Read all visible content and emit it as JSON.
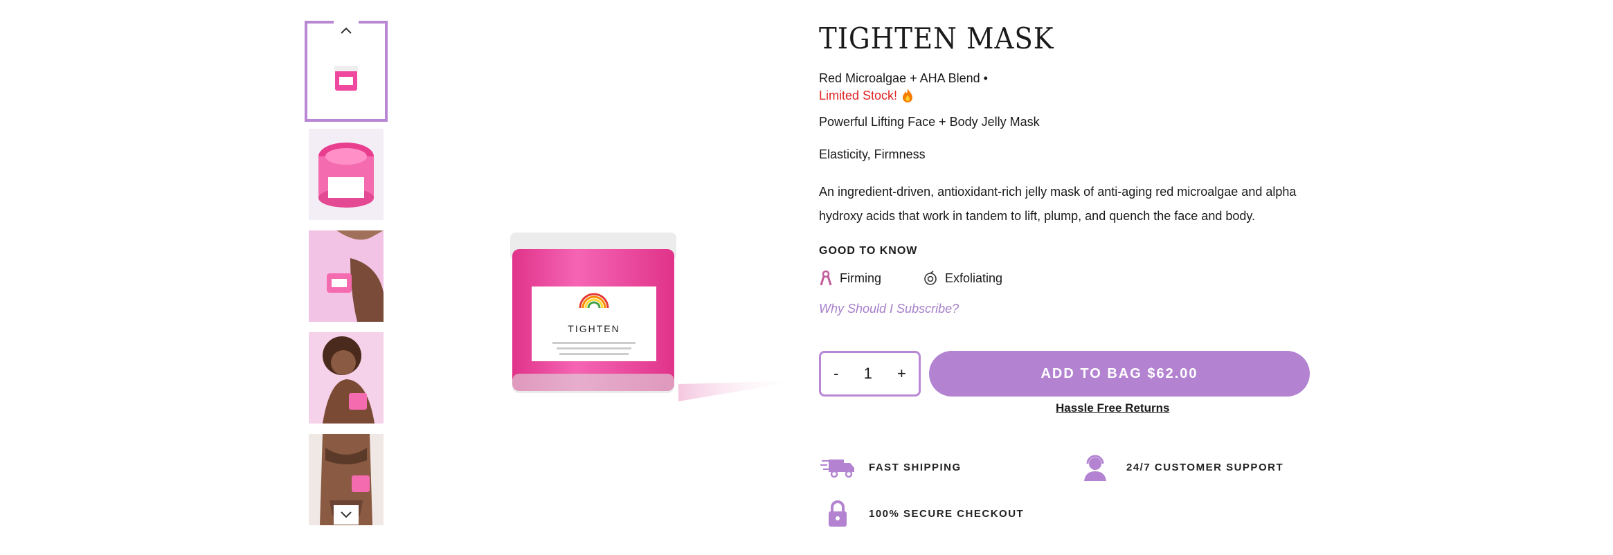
{
  "product": {
    "title": "TIGHTEN MASK",
    "subtitle": "Red Microalgae + AHA Blend •",
    "stock": "Limited Stock!",
    "tagline": "Powerful Lifting Face + Body Jelly Mask",
    "benefits": "Elasticity, Firmness",
    "description": "An ingredient-driven, antioxidant-rich jelly mask of anti-aging red microalgae and alpha hydroxy acids that work in tandem to lift, plump, and quench the face and body.",
    "jar_label": "TIGHTEN"
  },
  "good_to_know": {
    "heading": "GOOD TO KNOW",
    "items": [
      {
        "label": "Firming",
        "icon": "ribbon-icon"
      },
      {
        "label": "Exfoliating",
        "icon": "swirl-icon"
      }
    ]
  },
  "subscribe_link": "Why Should I Subscribe?",
  "quantity": {
    "minus": "-",
    "value": "1",
    "plus": "+"
  },
  "add_to_bag": "ADD TO BAG $62.00",
  "returns_link": "Hassle Free Returns",
  "features": [
    {
      "label": "FAST SHIPPING",
      "icon": "truck-icon"
    },
    {
      "label": "24/7 CUSTOMER SUPPORT",
      "icon": "support-agent-icon"
    },
    {
      "label": "100% SECURE CHECKOUT",
      "icon": "lock-icon"
    }
  ],
  "colors": {
    "accent": "#b383d2",
    "stock": "#e02424",
    "jar_pink": "#f0489e"
  }
}
